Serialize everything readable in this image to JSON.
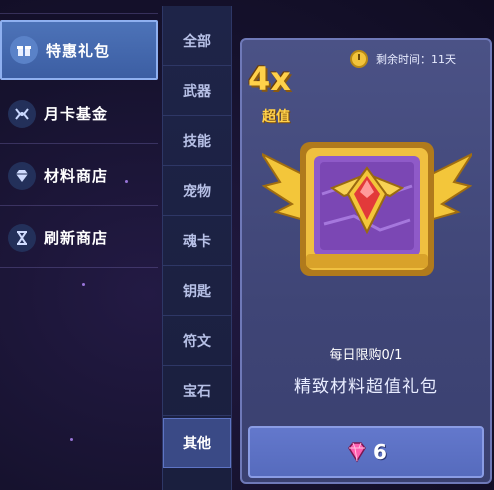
{
  "sidebar": {
    "items": [
      {
        "label": "特惠礼包",
        "icon": "gift-icon",
        "active": true
      },
      {
        "label": "月卡基金",
        "icon": "card-fund-icon",
        "active": false
      },
      {
        "label": "材料商店",
        "icon": "diamond-icon",
        "active": false
      },
      {
        "label": "刷新商店",
        "icon": "hourglass-icon",
        "active": false
      }
    ]
  },
  "categories": [
    {
      "label": "全部"
    },
    {
      "label": "武器"
    },
    {
      "label": "技能"
    },
    {
      "label": "宠物"
    },
    {
      "label": "魂卡"
    },
    {
      "label": "钥匙"
    },
    {
      "label": "符文"
    },
    {
      "label": "宝石"
    },
    {
      "label": "其他",
      "active": true
    }
  ],
  "card": {
    "timer_text": "剩余时间：11天",
    "multiplier": "4x",
    "value_tag": "超值",
    "limit_text": "每日限购0/1",
    "name": "精致材料超值礼包",
    "price": "6",
    "price_icon": "gem-icon"
  },
  "colors": {
    "accent_gold": "#ffd14a",
    "active_tab": "#4d73b8",
    "card_bg": "#4b5286",
    "button_bg": "#6378cc",
    "gem_pink": "#ff5fb0"
  }
}
